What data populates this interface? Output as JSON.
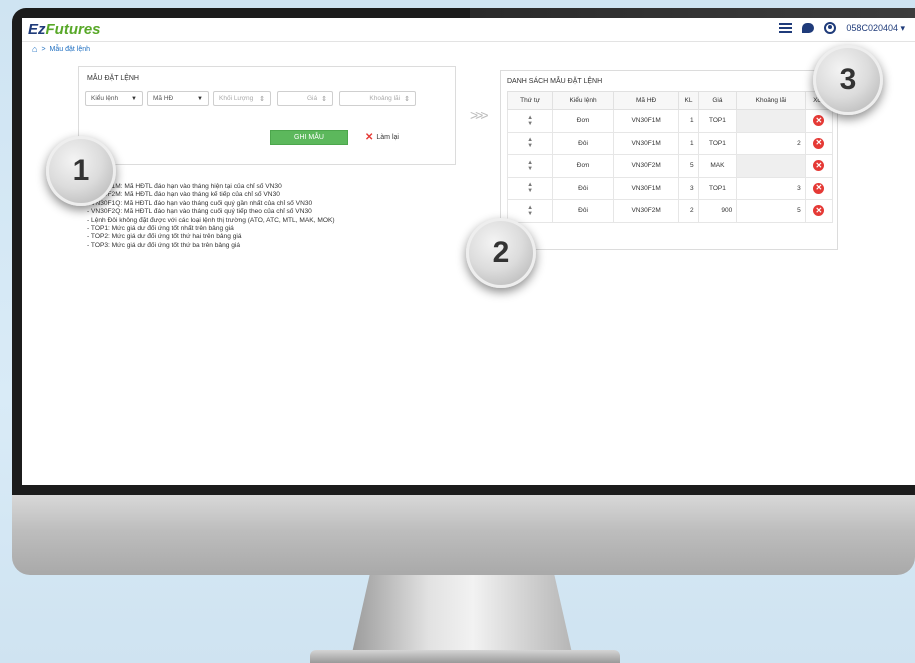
{
  "header": {
    "logo_ez": "Ez",
    "logo_futures": "Futures",
    "account": "058C020404 ▾"
  },
  "breadcrumb": {
    "separator": ">",
    "current": "Mẫu đặt lệnh"
  },
  "form": {
    "title": "MẪU ĐẶT LỆNH",
    "order_type": "Kiểu lệnh",
    "contract_code": "Mã HĐ",
    "quantity_placeholder": "Khối Lượng",
    "price_placeholder": "Giá",
    "gap_placeholder": "Khoảng lãi",
    "save_label": "GHI MẪU",
    "reset_label": "Làm lại"
  },
  "notes": [
    "- VN30F1M: Mã HĐTL đáo hạn vào tháng hiện tại của chỉ số VN30",
    "- VN30F2M: Mã HĐTL đáo hạn vào tháng kế tiếp của chỉ số VN30",
    "- VN30F1Q: Mã HĐTL đáo hạn vào tháng cuối quý gần nhất của chỉ số VN30",
    "- VN30F2Q: Mã HĐTL đáo hạn vào tháng cuối quý tiếp theo của chỉ số VN30",
    "- Lệnh Đôi không đặt được với các loại lệnh thị trường (ATO, ATC, MTL, MAK, MOK)",
    "- TOP1: Mức giá dư đối ứng tốt nhất trên bảng giá",
    "- TOP2: Mức giá dư đối ứng tốt thứ hai trên bảng giá",
    "- TOP3: Mức giá dư đối ứng tốt thứ ba trên bảng giá"
  ],
  "list": {
    "title": "DANH SÁCH MẪU ĐẶT LỆNH",
    "columns": [
      "Thứ tự",
      "Kiểu lệnh",
      "Mã HĐ",
      "KL",
      "Giá",
      "Khoảng lãi",
      "Xóa"
    ],
    "rows": [
      {
        "type": "Đơn",
        "code": "VN30F1M",
        "qty": "1",
        "price": "TOP1",
        "gap": ""
      },
      {
        "type": "Đôi",
        "code": "VN30F1M",
        "qty": "1",
        "price": "TOP1",
        "gap": "2"
      },
      {
        "type": "Đơn",
        "code": "VN30F2M",
        "qty": "5",
        "price": "MAK",
        "gap": ""
      },
      {
        "type": "Đôi",
        "code": "VN30F1M",
        "qty": "3",
        "price": "TOP1",
        "gap": "3"
      },
      {
        "type": "Đôi",
        "code": "VN30F2M",
        "qty": "2",
        "price": "900",
        "gap": "5"
      }
    ]
  },
  "callouts": {
    "one": "1",
    "two": "2",
    "three": "3"
  },
  "colors": {
    "brand_blue": "#1f3b7a",
    "brand_green": "#58a828",
    "save_green": "#5cb85c",
    "delete_red": "#e53935"
  }
}
